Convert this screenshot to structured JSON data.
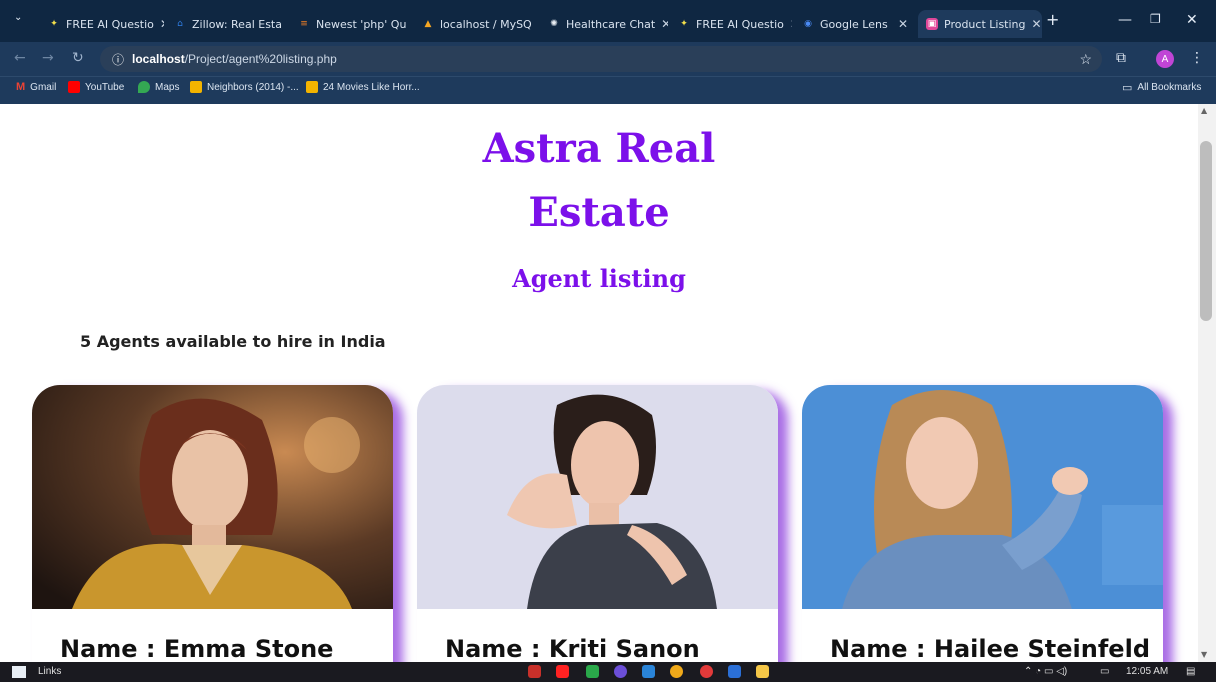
{
  "browser": {
    "tabs": [
      {
        "label": "FREE AI Questio",
        "icon": "sparkle-icon",
        "color": "#f3e04b"
      },
      {
        "label": "Zillow: Real Esta",
        "icon": "house-icon",
        "color": "#2e7de3"
      },
      {
        "label": "Newest 'php' Qu",
        "icon": "stackoverflow-icon",
        "color": "#f48024"
      },
      {
        "label": "localhost / MySQ",
        "icon": "phpmyadmin-icon",
        "color": "#f5a623"
      },
      {
        "label": "Healthcare Chat",
        "icon": "chatgpt-icon",
        "color": "#e9eef4"
      },
      {
        "label": "FREE AI Questio",
        "icon": "sparkle-icon",
        "color": "#f3e04b"
      },
      {
        "label": "Google Lens",
        "icon": "lens-icon",
        "color": "#4a8af4"
      },
      {
        "label": "Product Listing",
        "icon": "app-icon",
        "color": "#e0489a"
      }
    ],
    "url_host": "localhost",
    "url_path": "/Project/agent%20listing.php",
    "bookmarks": [
      {
        "label": "Gmail",
        "color": "#ea4335"
      },
      {
        "label": "YouTube",
        "color": "#ff0000"
      },
      {
        "label": "Maps",
        "color": "#34a853"
      },
      {
        "label": "Neighbors (2014) -...",
        "color": "#f4b400"
      },
      {
        "label": "24 Movies Like Horr...",
        "color": "#f4b400"
      }
    ],
    "all_bookmarks": "All Bookmarks",
    "profile_initial": "A"
  },
  "page": {
    "title_line1": "Astra Real",
    "title_line2": "Estate",
    "subtitle": "Agent listing",
    "agent_count": "5 Agents available to hire in India",
    "agents": [
      {
        "name": "Name : Emma Stone"
      },
      {
        "name": "Name : Kriti Sanon"
      },
      {
        "name": "Name : Hailee Steinfeld"
      }
    ]
  },
  "taskbar": {
    "links_label": "Links",
    "time": "12:05 AM"
  },
  "colors": {
    "accent": "#7c10ea"
  }
}
